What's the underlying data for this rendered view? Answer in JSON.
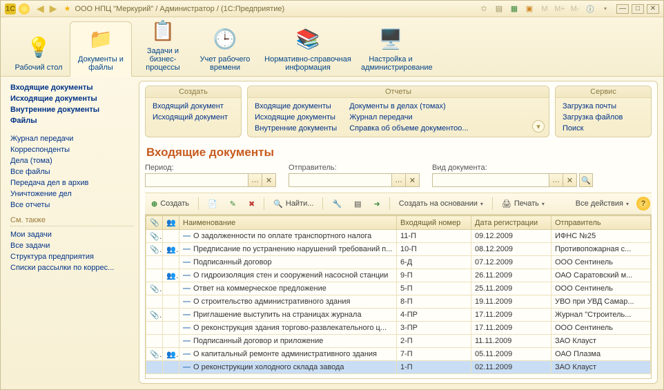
{
  "titlebar": {
    "app_logo": "1C",
    "title": "ООО НПЦ \"Меркурий\" / Администратор /  (1С:Предприятие)"
  },
  "main_tabs": [
    {
      "label": "Рабочий стол",
      "icon": "💡"
    },
    {
      "label": "Документы и файлы",
      "icon": "📁",
      "active": true
    },
    {
      "label": "Задачи и бизнес-процессы",
      "icon": "📋"
    },
    {
      "label": "Учет рабочего времени",
      "icon": "🕒"
    },
    {
      "label": "Нормативно-справочная информация",
      "icon": "📚"
    },
    {
      "label": "Настройка и администрирование",
      "icon": "🖥️"
    }
  ],
  "cmd_panels": {
    "create": {
      "title": "Создать",
      "items": [
        "Входящий документ",
        "Исходящий документ"
      ]
    },
    "reports": {
      "title": "Отчеты",
      "cols": [
        [
          "Входящие документы",
          "Исходящие документы",
          "Внутренние документы"
        ],
        [
          "Документы в делах (томах)",
          "Журнал передачи",
          "Справка об объеме документоо..."
        ]
      ]
    },
    "service": {
      "title": "Сервис",
      "items": [
        "Загрузка почты",
        "Загрузка файлов",
        "Поиск"
      ]
    }
  },
  "sidebar": {
    "primary": [
      "Входящие документы",
      "Исходящие документы",
      "Внутренние документы",
      "Файлы"
    ],
    "secondary": [
      "Журнал передачи",
      "Корреспонденты",
      "Дела (тома)",
      "Все файлы",
      "Передача дел в архив",
      "Уничтожение дел",
      "Все отчеты"
    ],
    "see_also_label": "См. также",
    "see_also": [
      "Мои задачи",
      "Все задачи",
      "Структура предприятия",
      "Списки рассылки по коррес..."
    ]
  },
  "page": {
    "title": "Входящие документы",
    "filters": {
      "period": {
        "label": "Период:",
        "value": ""
      },
      "sender": {
        "label": "Отправитель:",
        "value": ""
      },
      "doctype": {
        "label": "Вид документа:",
        "value": ""
      }
    },
    "toolbar": {
      "create": "Создать",
      "find": "Найти...",
      "base": "Создать на основании",
      "print": "Печать",
      "all_actions": "Все действия"
    },
    "columns": [
      "",
      "",
      "Наименование",
      "Входящий номер",
      "Дата регистрации",
      "Отправитель"
    ],
    "rows": [
      {
        "att": true,
        "usr": false,
        "name": "О задолженности по оплате транспортного налога",
        "num": "11-П",
        "date": "09.12.2009",
        "from": "ИФНС №25"
      },
      {
        "att": true,
        "usr": true,
        "name": "Предписание по устранению нарушений требований п...",
        "num": "10-П",
        "date": "08.12.2009",
        "from": "Противопожарная с..."
      },
      {
        "att": false,
        "usr": false,
        "name": "Подписанный договор",
        "num": "6-Д",
        "date": "07.12.2009",
        "from": "ООО Сентинель"
      },
      {
        "att": false,
        "usr": true,
        "name": "О гидроизоляция стен и сооружений насосной станции",
        "num": "9-П",
        "date": "26.11.2009",
        "from": "ОАО Саратовский м..."
      },
      {
        "att": true,
        "usr": false,
        "name": "Ответ на коммерческое предложение",
        "num": "5-П",
        "date": "25.11.2009",
        "from": "ООО Сентинель"
      },
      {
        "att": false,
        "usr": false,
        "name": "О строительство административного здания",
        "num": "8-П",
        "date": "19.11.2009",
        "from": "УВО при УВД Самар..."
      },
      {
        "att": true,
        "usr": false,
        "name": "Приглашение выступить на страницах журнала",
        "num": "4-ПР",
        "date": "17.11.2009",
        "from": "Журнал \"Строитель..."
      },
      {
        "att": false,
        "usr": false,
        "name": "О реконструкция здания торгово-развлекательного ц...",
        "num": "3-ПР",
        "date": "17.11.2009",
        "from": "ООО Сентинель"
      },
      {
        "att": false,
        "usr": false,
        "name": "Подписанный договор и приложение",
        "num": "2-П",
        "date": "11.11.2009",
        "from": "ЗАО Клауст"
      },
      {
        "att": true,
        "usr": true,
        "name": "О капитальный ремонте административного здания",
        "num": "7-П",
        "date": "05.11.2009",
        "from": "ОАО Плазма"
      },
      {
        "att": false,
        "usr": false,
        "name": "О реконструкции холодного склада завода",
        "num": "1-П",
        "date": "02.11.2009",
        "from": "ЗАО Клауст",
        "selected": true
      }
    ]
  }
}
